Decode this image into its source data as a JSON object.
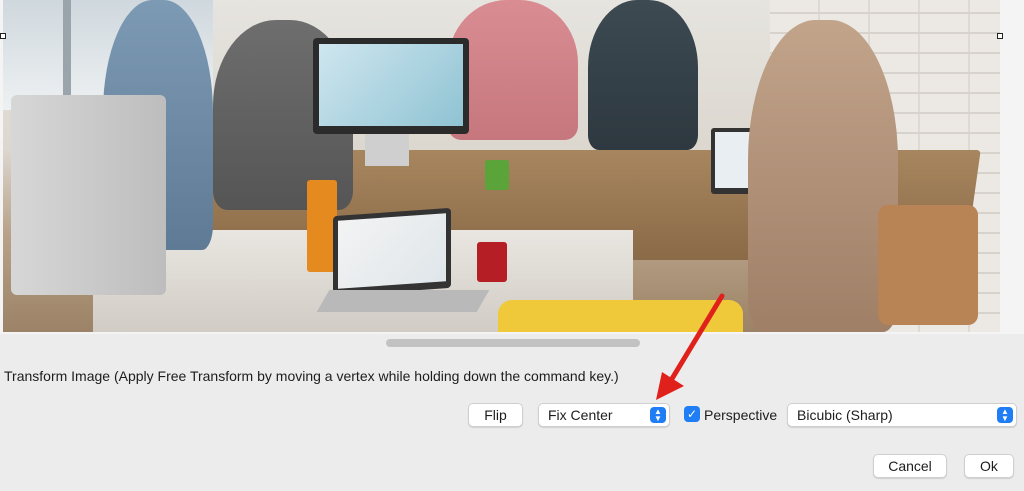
{
  "canvas": {
    "image_description_hidden": ""
  },
  "dialog": {
    "instruction": "Transform Image (Apply Free Transform by moving a vertex while holding down the command key.)",
    "flip_label": "Flip",
    "anchor_select": {
      "value": "Fix Center"
    },
    "perspective": {
      "label": "Perspective",
      "checked": true
    },
    "interpolation_select": {
      "value": "Bicubic (Sharp)"
    },
    "cancel_label": "Cancel",
    "ok_label": "Ok"
  },
  "colors": {
    "accent": "#1f7ef5",
    "annotation_arrow": "#e0201b"
  },
  "icons": {
    "stepper": "chevron-up-down-icon",
    "check": "checkmark-icon",
    "arrow": "annotation-arrow-icon"
  }
}
